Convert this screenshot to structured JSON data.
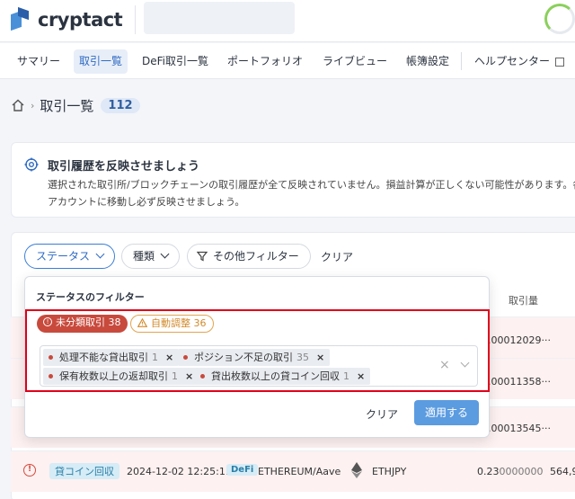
{
  "app": {
    "logo_text": "cryptact"
  },
  "nav": {
    "items": [
      "サマリー",
      "取引一覧",
      "DeFi取引一覧",
      "ポートフォリオ",
      "ライブビュー",
      "帳簿設定"
    ],
    "help": "ヘルプセンター"
  },
  "breadcrumb": {
    "title": "取引一覧",
    "count": "112"
  },
  "notice": {
    "title": "取引履歴を反映させましょう",
    "body": "選択された取引所/ブロックチェーンの取引履歴が全て反映されていません。損益計算が正しくない可能性があります。各アカウントに移動し必ず反映させましょう。"
  },
  "filters": {
    "status": "ステータス",
    "type": "種類",
    "other": "その他フィルター",
    "clear": "クリア"
  },
  "table": {
    "col_amount": "取引量",
    "bg_values": [
      "0.00012029···",
      "0.00011358···",
      "0.00013545···"
    ]
  },
  "row": {
    "tag": "貸コイン回収",
    "date": "2024-12-02 12:25:11",
    "defi": "DeFi",
    "network": "ETHEREUM/Aave",
    "pair": "ETHJPY",
    "amount": "0.23",
    "amount_rest": "0000000",
    "amount2": "564,9"
  },
  "status_filter": {
    "title": "ステータスのフィルター",
    "pill_unclassified": "未分類取引 38",
    "pill_auto": "自動調整 36",
    "tags": [
      {
        "label": "処理不能な貸出取引",
        "count": "1"
      },
      {
        "label": "ポジション不足の取引",
        "count": "35"
      },
      {
        "label": "保有枚数以上の返却取引",
        "count": "1"
      },
      {
        "label": "貸出枚数以上の貸コイン回収",
        "count": "1"
      }
    ],
    "clear": "クリア",
    "apply": "適用する"
  },
  "colors": {
    "accent": "#2f6bc4",
    "danger": "#c84a3d",
    "warning": "#d28a2b",
    "highlight": "#e1001a",
    "apply": "#5b9be0"
  }
}
